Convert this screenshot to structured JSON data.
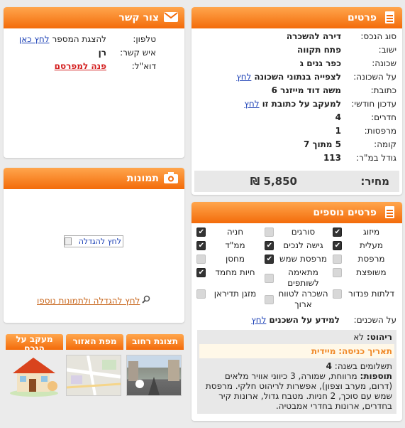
{
  "details": {
    "title": "פרטים",
    "rows": [
      {
        "label": "סוג הנכס:",
        "value": "דירה להשכרה"
      },
      {
        "label": "ישוב:",
        "value": "פתח תקווה"
      },
      {
        "label": "שכונה:",
        "value": "כפר גנים ג"
      },
      {
        "label": "על השכונה:",
        "value": "לצפייה בנתוני השכונה",
        "link": "לחץ"
      },
      {
        "label": "כתובת:",
        "value": "משה דוד מייזנר 6"
      },
      {
        "label": "עדכון חודשי:",
        "value": "למעקב על כתובת זו",
        "link": "לחץ"
      },
      {
        "label": "חדרים:",
        "value": "4"
      },
      {
        "label": "מרפסות:",
        "value": "1"
      },
      {
        "label": "קומה:",
        "value": "5 מתוך 7"
      },
      {
        "label": "גודל במ\"ר:",
        "value": "113"
      }
    ],
    "price_label": "מחיר:",
    "price_value": "5,850 ₪"
  },
  "contact": {
    "title": "צור קשר",
    "phone_label": "טלפון:",
    "phone_text": "להצגת המספר",
    "phone_link": "לחץ כאן",
    "person_label": "איש קשר:",
    "person_value": "רן",
    "email_label": "דוא\"ל:",
    "email_link": "פנה למפרסם"
  },
  "photos": {
    "title": "תמונות",
    "enlarge_img_alt": "לחץ להגדלה",
    "more_link": "לחץ להגדלה ולתמונות נוספו"
  },
  "extra": {
    "title": "פרטים נוספים",
    "features": [
      {
        "label": "מיזוג",
        "checked": true
      },
      {
        "label": "סורגים",
        "checked": false
      },
      {
        "label": "חניה",
        "checked": true
      },
      {
        "label": "מעלית",
        "checked": true
      },
      {
        "label": "גישה לנכים",
        "checked": true
      },
      {
        "label": "ממ\"ד",
        "checked": true
      },
      {
        "label": "מרפסת",
        "checked": false
      },
      {
        "label": "מרפסת שמש",
        "checked": true
      },
      {
        "label": "מחסן",
        "checked": false
      },
      {
        "label": "משופצת",
        "checked": false
      },
      {
        "label": "מתאימה לשותפים",
        "checked": false
      },
      {
        "label": "חיות מחמד",
        "checked": true
      },
      {
        "label": "דלתות פנדור",
        "checked": false
      },
      {
        "label": "השכרה לטווח ארוך",
        "checked": false
      },
      {
        "label": "מזגן תדיראן",
        "checked": false
      }
    ],
    "neighbors_label": "על השכנים:",
    "neighbors_value": "למידע על השכנים",
    "neighbors_link": "לחץ",
    "furnish_label": "ריהוט:",
    "furnish_value": "לא",
    "entry_label": "תאריך כניסה:",
    "entry_value": "מיידית",
    "payments_label": "תשלומים בשנה:",
    "payments_value": "4",
    "additions_label": "תוספות:",
    "additions_value": "מרווחת, שמורה, 3 כיווני אוויר מלאים (דרום, מערב וצפון), אפשרות לריהוט חלקי. מרפסת שמש עם סוכך, 2 חניות. מטבח גדול, ארונות קיר בחדרים, ארונות בחדרי אמבטיה."
  },
  "tabs": {
    "street": "תצוגת רחוב",
    "map": "מפת האזור",
    "track": "מעקב על הנכס"
  }
}
